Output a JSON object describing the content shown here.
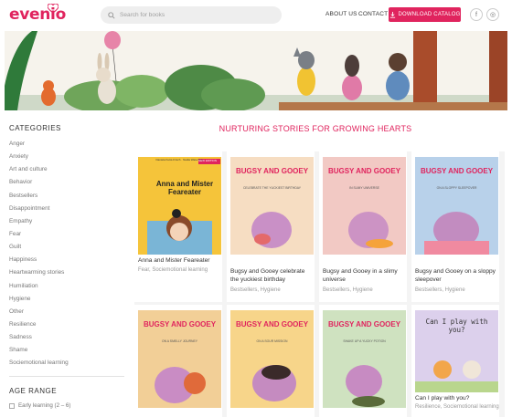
{
  "header": {
    "logo": "evenio",
    "search_placeholder": "Search for books",
    "nav": [
      "ABOUT US",
      "CONTACT"
    ],
    "catalog_button": "DOWNLOAD CATALOG",
    "social": [
      "f",
      "◎"
    ],
    "accent": "#e0245e"
  },
  "sidebar": {
    "categories_title": "CATEGORIES",
    "categories": [
      "Anger",
      "Anxiety",
      "Art and culture",
      "Behavior",
      "Bestsellers",
      "Disappointment",
      "Empathy",
      "Fear",
      "Guilt",
      "Happiness",
      "Heartwarming stories",
      "Humiliation",
      "Hygiene",
      "Other",
      "Resilience",
      "Sadness",
      "Shame",
      "Sociemotional learning"
    ],
    "age_title": "AGE RANGE",
    "age_options": [
      "Early learning (2 – 6)"
    ]
  },
  "main": {
    "heading": "NURTURING STORIES FOR GROWING HEARTS",
    "books": [
      {
        "title": "Anna and Mister Feareater",
        "tags": "Fear, Sociemotional learning",
        "cover_title": "Anna and Mister Feareater",
        "cover_top": "Daniela Kulot-Frisch · Nadia Waterbury",
        "cover_badge": "NEW EDITION"
      },
      {
        "title": "Bugsy and Gooey celebrate the yuckiest birthday",
        "tags": "Bestsellers, Hygiene",
        "cover_title": "BUGSY AND GOOEY",
        "cover_sub": "CELEBRATE THE YUCKIEST BIRTHDAY"
      },
      {
        "title": "Bugsy and Gooey in a slimy universe",
        "tags": "Bestsellers, Hygiene",
        "cover_title": "BUGSY AND GOOEY",
        "cover_sub": "IN SLIMY UNIVERSE"
      },
      {
        "title": "Bugsy and Gooey on a sloppy sleepover",
        "tags": "Bestsellers, Hygiene",
        "cover_title": "BUGSY AND GOOEY",
        "cover_sub": "ON A SLOPPY SLEEPOVER"
      },
      {
        "title": "",
        "tags": "",
        "cover_title": "BUGSY AND GOOEY",
        "cover_sub": "ON A SMELLY JOURNEY"
      },
      {
        "title": "",
        "tags": "",
        "cover_title": "BUGSY AND GOOEY",
        "cover_sub": "ON A SOUR MISSION"
      },
      {
        "title": "",
        "tags": "",
        "cover_title": "BUGSY AND GOOEY",
        "cover_sub": "SHAKE UP A YUCKY POTION"
      },
      {
        "title": "Can I play with you?",
        "tags": "Resilience, Sociemotional learning",
        "cover_title": "Can I play with you?"
      }
    ]
  }
}
